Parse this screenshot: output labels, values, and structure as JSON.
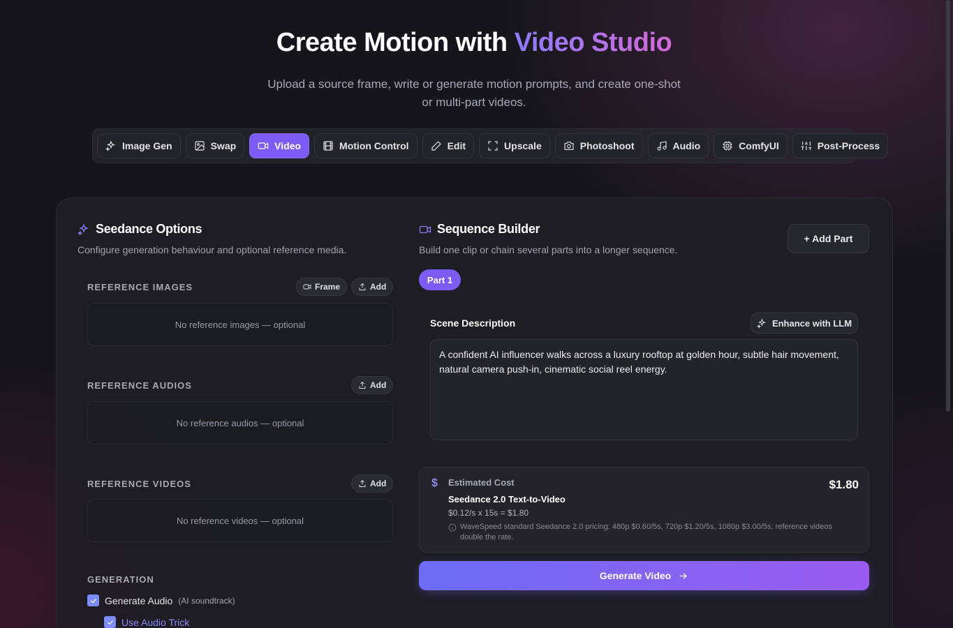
{
  "hero": {
    "title_prefix": "Create Motion with",
    "title_highlight": "Video Studio",
    "subtitle": "Upload a source frame, write or generate motion prompts, and create one-shot or multi-part videos."
  },
  "tabs": [
    {
      "label": "Image Gen",
      "icon": "sparkles-icon"
    },
    {
      "label": "Swap",
      "icon": "image-icon"
    },
    {
      "label": "Video",
      "icon": "video-icon",
      "active": true
    },
    {
      "label": "Motion Control",
      "icon": "film-icon"
    },
    {
      "label": "Edit",
      "icon": "pencil-icon"
    },
    {
      "label": "Upscale",
      "icon": "expand-icon"
    },
    {
      "label": "Photoshoot",
      "icon": "camera-icon"
    },
    {
      "label": "Audio",
      "icon": "music-icon"
    },
    {
      "label": "ComfyUI",
      "icon": "cpu-icon"
    },
    {
      "label": "Post-Process",
      "icon": "sliders-icon"
    }
  ],
  "options": {
    "title": "Seedance Options",
    "description": "Configure generation behaviour and optional reference media.",
    "reference_images": {
      "label": "REFERENCE IMAGES",
      "frame_label": "Frame",
      "add_label": "Add",
      "empty": "No reference images — optional"
    },
    "reference_audios": {
      "label": "REFERENCE AUDIOS",
      "add_label": "Add",
      "empty": "No reference audios — optional"
    },
    "reference_videos": {
      "label": "REFERENCE VIDEOS",
      "add_label": "Add",
      "empty": "No reference videos — optional"
    },
    "generation": {
      "label": "GENERATION",
      "generate_audio": {
        "label": "Generate Audio",
        "hint": "(AI soundtrack)",
        "checked": true
      },
      "audio_trick": {
        "label": "Use Audio Trick",
        "checked": true
      }
    }
  },
  "sequence": {
    "title": "Sequence Builder",
    "description": "Build one clip or chain several parts into a longer sequence.",
    "add_part_label": "+ Add Part",
    "parts": [
      "Part 1"
    ],
    "scene_label": "Scene Description",
    "enhance_label": "Enhance with LLM",
    "scene_text": "A confident AI influencer walks across a luxury rooftop at golden hour, subtle hair movement, natural camera push-in, cinematic social reel energy."
  },
  "cost": {
    "icon": "$",
    "title": "Estimated Cost",
    "amount": "$1.80",
    "model": "Seedance 2.0 Text-to-Video",
    "formula": "$0.12/s x 15s = $1.80",
    "note": "WaveSpeed standard Seedance 2.0 pricing: 480p $0.60/5s, 720p $1.20/5s, 1080p $3.00/5s; reference videos double the rate."
  },
  "generate_label": "Generate Video"
}
